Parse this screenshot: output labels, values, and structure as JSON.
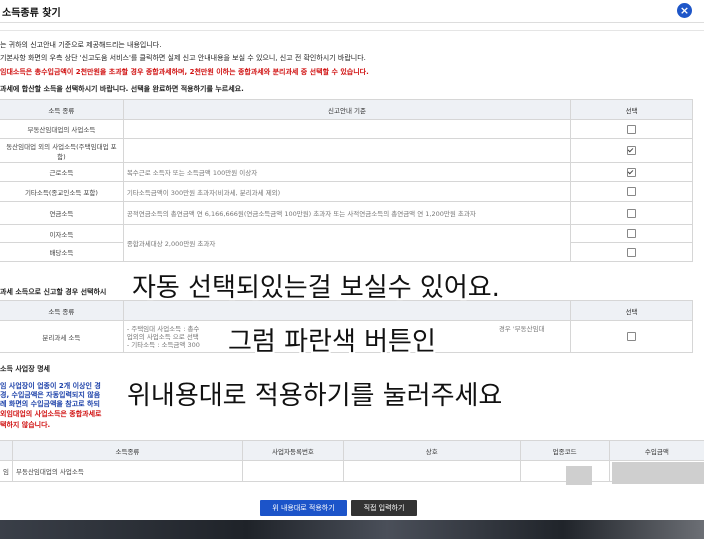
{
  "dialog": {
    "title": "소득종류 찾기",
    "close_symbol": "×"
  },
  "notes": [
    {
      "text": "는 귀하의 신고안내 기준으로 제공해드리는 내용입니다.",
      "color": "black"
    },
    {
      "text": "기본사항 화면의 우측 상단 '신고도움 서비스'를 클릭하면 실제 신고 안내내용을 보실 수 있으니, 신고 전 확인하시기 바랍니다.",
      "color": "black"
    },
    {
      "text": "임대소득은 총수입금액이 2천만원을 초과할 경우 종합과세하며, 2천만원 이하는 종합과세와 분리과세 중 선택할 수 있습니다.",
      "color": "red"
    },
    {
      "text": "과세에 합산할 소득을 선택하시기 바랍니다. 선택을 완료하면 적용하기를 누르세요.",
      "color": "black"
    }
  ],
  "main_table": {
    "headers": [
      "소득 종류",
      "신고안내 기준",
      "선택"
    ],
    "rows": [
      {
        "type": "부동산임대업의 사업소득",
        "criteria": "",
        "checked": false
      },
      {
        "type": "동산임대업 외의 사업소득(주택임대업 포함)",
        "criteria": "",
        "checked": true
      },
      {
        "type": "근로소득",
        "criteria": "복수근로 소득자 또는 소득금액 100만원 이상자",
        "checked": true
      },
      {
        "type": "기타소득(종교인소득 포함)",
        "criteria": "기타소득금액이 300만원 초과자(비과세, 분리과세 제외)",
        "checked": false
      },
      {
        "type": "연금소득",
        "criteria": "공적연금소득의 총연금액 연 6,166,666원(연금소득금액 100만원) 초과자 또는 사적연금소득의 총연금액 연 1,200만원 초과자",
        "checked": false
      },
      {
        "type": "이자소득",
        "criteria": "종합과세대상 2,000만원 초과자",
        "checked": false
      },
      {
        "type": "배당소득",
        "criteria": "",
        "checked": false
      }
    ]
  },
  "separate_section": {
    "title": "과세 소득으로 신고할 경우 선택하시",
    "headers": [
      "소득 종류",
      "",
      "선택"
    ],
    "row": {
      "type": "분리과세 소득",
      "criteria_lines": [
        "- 주택임대 사업소득 : 총수",
        "업외의 사업소득 으로 선택",
        "- 기타소득 : 소득금액 300"
      ],
      "criteria_tail": "경우 '부동산임대",
      "checked": false
    }
  },
  "business_section": {
    "title": "소득 사업장 명세",
    "notes": [
      {
        "text": "임 사업장이 업종이 2개 이상인 경",
        "color": "blue"
      },
      {
        "text": "경, 수입금액은 자동입력되지 않음",
        "color": "blue"
      },
      {
        "text": "례 화면의 수입금액을 참고로 하되",
        "color": "blue"
      },
      {
        "text": "외임대업의 사업소득은 종합과세로",
        "color": "red"
      },
      {
        "text": "택하지 않습니다.",
        "color": "red"
      }
    ],
    "headers": [
      "",
      "소득종류",
      "사업자등록번호",
      "상호",
      "업종코드",
      "수입금액"
    ],
    "rows": [
      {
        "prefix": "임",
        "type": "부동산임대업의 사업소득",
        "reg": "",
        "name": "",
        "code": "",
        "amount": ""
      }
    ]
  },
  "overlay": {
    "line1": "자동 선택되있는걸 보실수 있어요.",
    "line2": "그럼 파란색 버튼인",
    "line3": "위내용대로 적용하기를 눌러주세요"
  },
  "buttons": {
    "apply": "위 내용대로 적용하기",
    "manual": "직접 입력하기"
  },
  "colors": {
    "accent": "#1c54c9",
    "red": "#d01010",
    "blue_note": "#1a3fa8"
  }
}
